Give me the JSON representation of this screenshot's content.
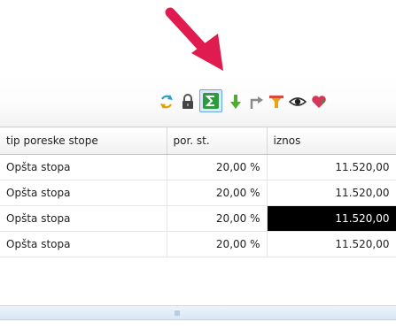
{
  "colors": {
    "arrow": "#e01b4f",
    "selected_cell_bg": "#000000",
    "selected_cell_text": "#ffffff",
    "active_button_border": "#6aa6e0"
  },
  "toolbar": {
    "buttons": [
      {
        "icon": "refresh-icon"
      },
      {
        "icon": "lock-icon"
      },
      {
        "icon": "sum-icon",
        "active": true
      },
      {
        "icon": "download-arrow-icon"
      },
      {
        "icon": "redirect-arrow-icon"
      },
      {
        "icon": "filter-icon"
      },
      {
        "icon": "eye-icon"
      },
      {
        "icon": "heart-icon"
      }
    ]
  },
  "table": {
    "columns": [
      "tip poreske stope",
      "por. st.",
      "iznos"
    ],
    "rows": [
      {
        "tip": "Opšta stopa",
        "stopa": "20,00 %",
        "iznos": "11.520,00"
      },
      {
        "tip": "Opšta stopa",
        "stopa": "20,00 %",
        "iznos": "11.520,00"
      },
      {
        "tip": "Opšta stopa",
        "stopa": "20,00 %",
        "iznos": "11.520,00"
      },
      {
        "tip": "Opšta stopa",
        "stopa": "20,00 %",
        "iznos": "11.520,00"
      }
    ],
    "selected_cell": {
      "row": 2,
      "column": "iznos"
    }
  }
}
